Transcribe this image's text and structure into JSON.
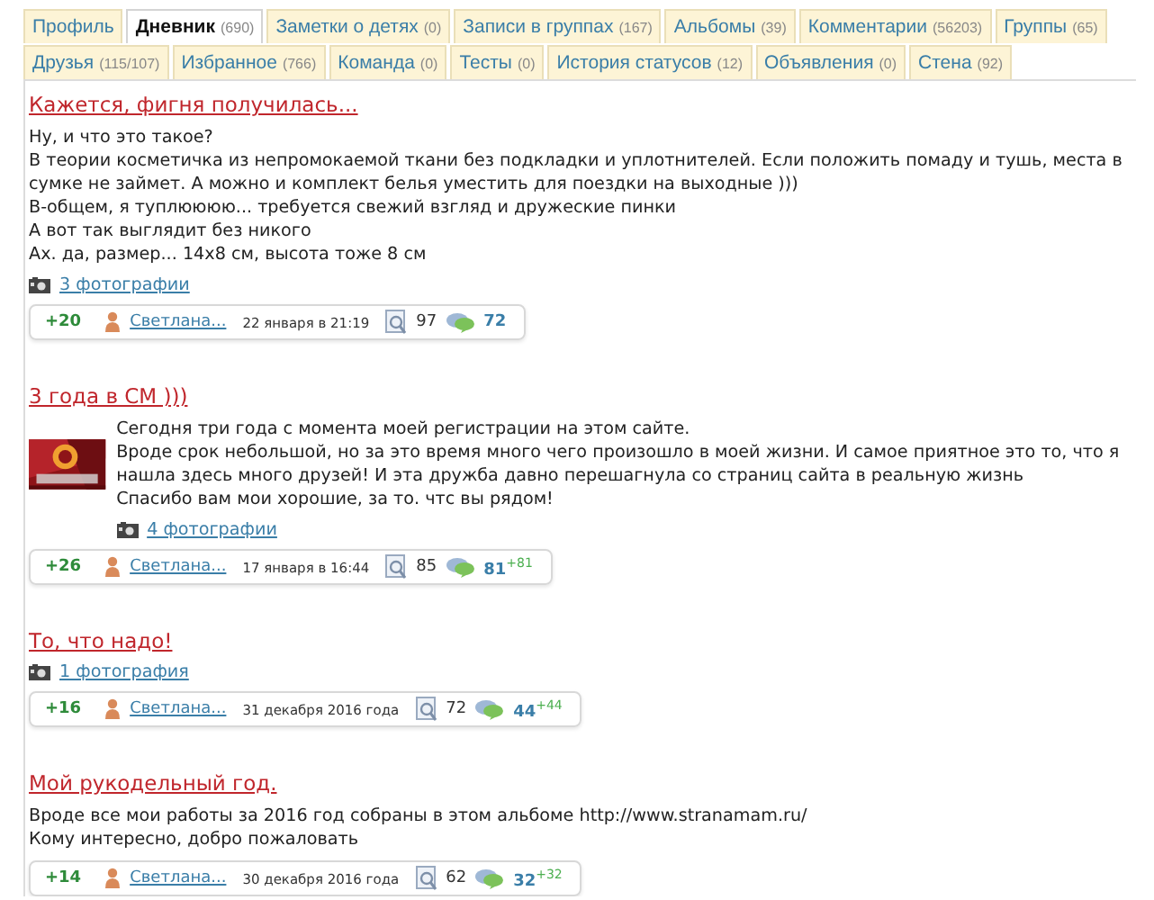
{
  "tabs": [
    {
      "label": "Профиль",
      "selected": false
    },
    {
      "label": "Дневник",
      "count": "(690)",
      "selected": true
    },
    {
      "label": "Заметки о детях",
      "count": "(0)",
      "selected": false
    },
    {
      "label": "Записи в группах",
      "count": "(167)",
      "selected": false
    },
    {
      "label": "Альбомы",
      "count": "(39)",
      "selected": false
    },
    {
      "label": "Комментарии",
      "count": "(56203)",
      "selected": false
    },
    {
      "label": "Группы",
      "count": "(65)",
      "selected": false
    },
    {
      "label": "Друзья",
      "count": "(115/107)",
      "selected": false
    },
    {
      "label": "Избранное",
      "count": "(766)",
      "selected": false
    },
    {
      "label": "Команда",
      "count": "(0)",
      "selected": false
    },
    {
      "label": "Тесты",
      "count": "(0)",
      "selected": false
    },
    {
      "label": "История статусов",
      "count": "(12)",
      "selected": false
    },
    {
      "label": "Объявления",
      "count": "(0)",
      "selected": false
    },
    {
      "label": "Стена",
      "count": "(92)",
      "selected": false
    }
  ],
  "posts": [
    {
      "title": "Кажется, фигня получилась...",
      "lines": [
        "Ну, и что это такое?",
        "В теории косметичка из непромокаемой ткани без подкладки и уплотнителей. Если положить помаду и тушь, места в сумке не займет. А можно и комплект белья уместить для поездки на выходные )))",
        "В-общем, я туплюююю... требуется свежий взгляд и дружеские пинки",
        "А вот так выглядит без никого",
        "Ах. да, размер... 14х8 см, высота тоже 8 см"
      ],
      "photos": "3 фотографии",
      "rating": "+20",
      "author": "Светлана...",
      "date": "22 января в 21:19",
      "views": "97",
      "comments": "72"
    },
    {
      "title": "3 года в СМ )))",
      "thumbnail": {
        "kind": "picture"
      },
      "lines": [
        "Сегодня три года с момента моей регистрации на этом сайте.",
        "Вроде срок небольшой, но за это время много чего произошло в моей жизни. И самое приятное это то, что я нашла здесь много друзей! И эта дружба давно перешагнула со страниц сайта в реальную жизнь",
        "Спасибо вам мои хорошие, за то. чтс вы рядом!"
      ],
      "photos": "4 фотографии",
      "rating": "+26",
      "author": "Светлана...",
      "date": "17 января в 16:44",
      "views": "85",
      "comments": "81",
      "new_comments": "+81"
    },
    {
      "title": "То, что надо!",
      "photos": "1 фотография",
      "rating": "+16",
      "author": "Светлана...",
      "date": "31 декабря 2016 года",
      "views": "72",
      "comments": "44",
      "new_comments": "+44"
    },
    {
      "title": "Мой рукодельный год.",
      "lines": [
        "Вроде все мои работы за 2016 год собраны в этом альбоме http://www.stranamam.ru/",
        "Кому интересно, добро пожаловать"
      ],
      "rating": "+14",
      "author": "Светлана...",
      "date": "30 декабря 2016 года",
      "views": "62",
      "comments": "32",
      "new_comments": "+32"
    }
  ]
}
